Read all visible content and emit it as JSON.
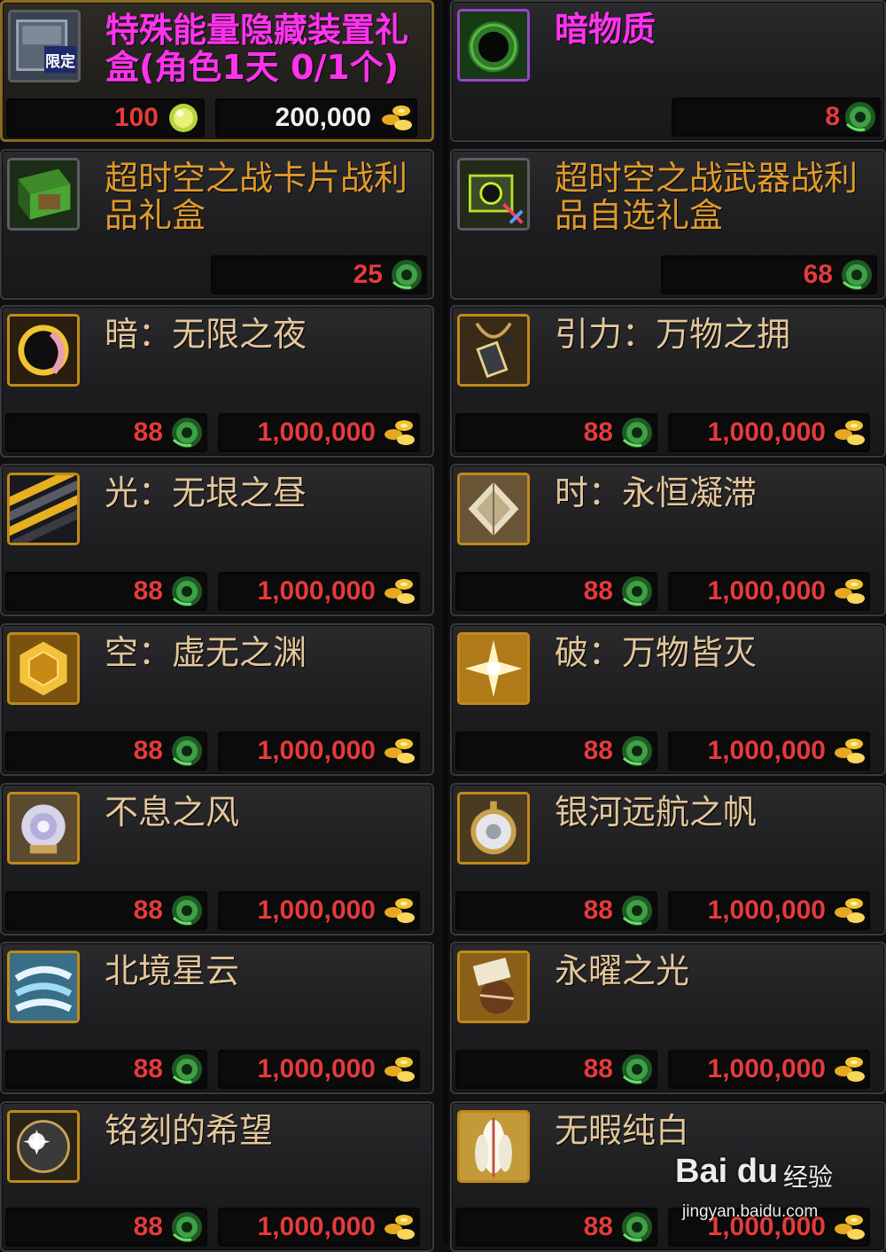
{
  "items": [
    {
      "name": "特殊能量隐藏装置礼盒(角色1天 0/1个)",
      "color": "magenta",
      "icon": "limited-box-icon",
      "icon_label": "限定",
      "frame": "gray",
      "selected": true,
      "p1": {
        "value": "100",
        "color": "red",
        "currency": "gold-coin-icon"
      },
      "p2": {
        "value": "200,000",
        "color": "white",
        "currency": "gold-ingot-icon"
      }
    },
    {
      "name": "暗物质",
      "color": "magenta",
      "icon": "dark-matter-icon",
      "frame": "purple",
      "p1": null,
      "p2": {
        "value": "8",
        "color": "red",
        "currency": "green-token-icon"
      }
    },
    {
      "name": "超时空之战卡片战利品礼盒",
      "color": "orange",
      "icon": "card-box-icon",
      "frame": "gray",
      "p1": null,
      "p2": {
        "value": "25",
        "color": "red",
        "currency": "green-token-icon"
      }
    },
    {
      "name": "超时空之战武器战利品自选礼盒",
      "color": "orange",
      "icon": "weapon-box-icon",
      "frame": "gray",
      "p1": null,
      "p2": {
        "value": "68",
        "color": "red",
        "currency": "green-token-icon"
      }
    },
    {
      "name": "暗：无限之夜",
      "color": "tan",
      "icon": "dark-orb-icon",
      "frame": "gold",
      "p1": {
        "value": "88",
        "color": "red",
        "currency": "green-token-icon"
      },
      "p2": {
        "value": "1,000,000",
        "color": "red",
        "currency": "gold-ingot-icon"
      }
    },
    {
      "name": "引力：万物之拥",
      "color": "tan",
      "icon": "gravity-necklace-icon",
      "frame": "gold",
      "p1": {
        "value": "88",
        "color": "red",
        "currency": "green-token-icon"
      },
      "p2": {
        "value": "1,000,000",
        "color": "red",
        "currency": "gold-ingot-icon"
      }
    },
    {
      "name": "光：无垠之昼",
      "color": "tan",
      "icon": "light-stripes-icon",
      "frame": "gold",
      "p1": {
        "value": "88",
        "color": "red",
        "currency": "green-token-icon"
      },
      "p2": {
        "value": "1,000,000",
        "color": "red",
        "currency": "gold-ingot-icon"
      }
    },
    {
      "name": "时：永恒凝滞",
      "color": "tan",
      "icon": "time-gem-icon",
      "frame": "gold",
      "p1": {
        "value": "88",
        "color": "red",
        "currency": "green-token-icon"
      },
      "p2": {
        "value": "1,000,000",
        "color": "red",
        "currency": "gold-ingot-icon"
      }
    },
    {
      "name": "空：虚无之渊",
      "color": "tan",
      "icon": "void-hexagon-icon",
      "frame": "gold",
      "p1": {
        "value": "88",
        "color": "red",
        "currency": "green-token-icon"
      },
      "p2": {
        "value": "1,000,000",
        "color": "red",
        "currency": "gold-ingot-icon"
      }
    },
    {
      "name": "破：万物皆灭",
      "color": "tan",
      "icon": "destruction-burst-icon",
      "frame": "gold",
      "p1": {
        "value": "88",
        "color": "red",
        "currency": "green-token-icon"
      },
      "p2": {
        "value": "1,000,000",
        "color": "red",
        "currency": "gold-ingot-icon"
      }
    },
    {
      "name": "不息之风",
      "color": "tan",
      "icon": "wind-rose-icon",
      "frame": "gold",
      "p1": {
        "value": "88",
        "color": "red",
        "currency": "green-token-icon"
      },
      "p2": {
        "value": "1,000,000",
        "color": "red",
        "currency": "gold-ingot-icon"
      }
    },
    {
      "name": "银河远航之帆",
      "color": "tan",
      "icon": "galaxy-pocketwatch-icon",
      "frame": "gold",
      "p1": {
        "value": "88",
        "color": "red",
        "currency": "green-token-icon"
      },
      "p2": {
        "value": "1,000,000",
        "color": "red",
        "currency": "gold-ingot-icon"
      }
    },
    {
      "name": "北境星云",
      "color": "tan",
      "icon": "nebula-swirl-icon",
      "frame": "gold",
      "p1": {
        "value": "88",
        "color": "red",
        "currency": "green-token-icon"
      },
      "p2": {
        "value": "1,000,000",
        "color": "red",
        "currency": "gold-ingot-icon"
      }
    },
    {
      "name": "永曜之光",
      "color": "tan",
      "icon": "radiant-pouch-icon",
      "frame": "gold",
      "p1": {
        "value": "88",
        "color": "red",
        "currency": "green-token-icon"
      },
      "p2": {
        "value": "1,000,000",
        "color": "red",
        "currency": "gold-ingot-icon"
      }
    },
    {
      "name": "铭刻的希望",
      "color": "tan",
      "icon": "engraved-orb-icon",
      "frame": "gold",
      "p1": {
        "value": "88",
        "color": "red",
        "currency": "green-token-icon"
      },
      "p2": {
        "value": "1,000,000",
        "color": "red",
        "currency": "gold-ingot-icon"
      }
    },
    {
      "name": "无暇纯白",
      "color": "tan",
      "icon": "white-feather-icon",
      "frame": "gold",
      "p1": {
        "value": "88",
        "color": "red",
        "currency": "green-token-icon"
      },
      "p2": {
        "value": "1,000,000",
        "color": "red",
        "currency": "gold-ingot-icon"
      }
    }
  ],
  "watermark": {
    "brand": "Bai du",
    "label": "经验",
    "url": "jingyan.baidu.com"
  },
  "colors": {
    "magenta": "#ff33ee",
    "orange": "#e09a2c",
    "tan": "#e4c69a",
    "red": "#e43b3b",
    "gold_frame": "#c08a1a",
    "purple_frame": "#9a44c8"
  }
}
